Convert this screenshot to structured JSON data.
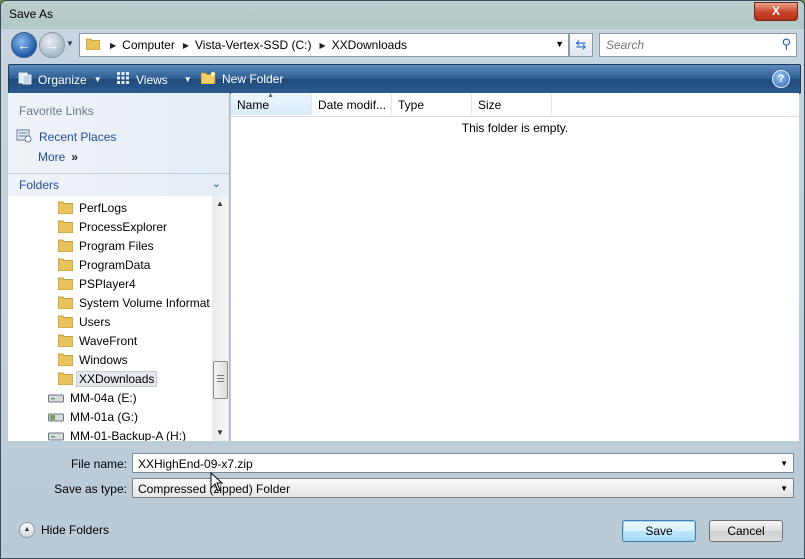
{
  "window": {
    "title": "Save As",
    "close_label": "X"
  },
  "address": {
    "breadcrumbs": [
      "Computer",
      "Vista-Vertex-SSD (C:)",
      "XXDownloads"
    ]
  },
  "search": {
    "placeholder": "Search"
  },
  "toolbar": {
    "organize_label": "Organize",
    "views_label": "Views",
    "new_folder_label": "New Folder"
  },
  "favorites": {
    "header": "Favorite Links",
    "items": [
      {
        "label": "Recent Places",
        "icon": "recent-places-icon"
      },
      {
        "label": "More",
        "icon": "double-chevron-icon"
      }
    ]
  },
  "folders": {
    "header": "Folders",
    "tree": [
      {
        "label": "PerfLogs",
        "icon": "folder-icon"
      },
      {
        "label": "ProcessExplorer",
        "icon": "folder-icon"
      },
      {
        "label": "Program Files",
        "icon": "folder-icon"
      },
      {
        "label": "ProgramData",
        "icon": "folder-icon"
      },
      {
        "label": "PSPlayer4",
        "icon": "folder-icon"
      },
      {
        "label": "System Volume Informat",
        "icon": "folder-icon"
      },
      {
        "label": "Users",
        "icon": "folder-icon"
      },
      {
        "label": "WaveFront",
        "icon": "folder-icon"
      },
      {
        "label": "Windows",
        "icon": "folder-icon"
      },
      {
        "label": "XXDownloads",
        "icon": "folder-icon",
        "selected": true
      },
      {
        "label": "MM-04a (E:)",
        "icon": "drive-icon"
      },
      {
        "label": "MM-01a (G:)",
        "icon": "drive-icon"
      },
      {
        "label": "MM-01-Backup-A (H:)",
        "icon": "drive-icon"
      }
    ]
  },
  "filelist": {
    "columns": [
      "Name",
      "Date modif...",
      "Type",
      "Size"
    ],
    "sorted_column": "Name",
    "empty_message": "This folder is empty."
  },
  "form": {
    "filename_label": "File name:",
    "filename_value": "XXHighEnd-09-x7.zip",
    "savetype_label": "Save as type:",
    "savetype_value": "Compressed (zipped) Folder"
  },
  "footer": {
    "hide_folders_label": "Hide Folders",
    "save_label": "Save",
    "cancel_label": "Cancel"
  }
}
